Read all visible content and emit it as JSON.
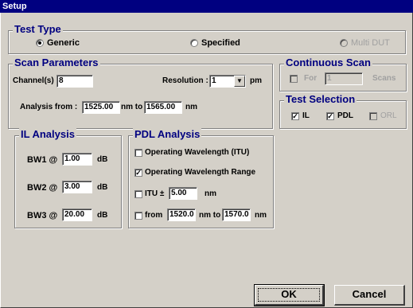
{
  "window": {
    "title": "Setup"
  },
  "test_type": {
    "legend": "Test Type",
    "options": [
      {
        "label": "Generic",
        "selected": true,
        "enabled": true
      },
      {
        "label": "Specified",
        "selected": false,
        "enabled": true
      },
      {
        "label": "Multi DUT",
        "selected": false,
        "enabled": false
      }
    ]
  },
  "scan_parameters": {
    "legend": "Scan Parameters",
    "channels_label": "Channel(s) :",
    "channels_value": "8",
    "resolution_label": "Resolution :",
    "resolution_value": "1",
    "resolution_unit": "pm",
    "analysis_from_label": "Analysis from :",
    "analysis_from_value": "1525.00",
    "nm_to_label": "nm to",
    "analysis_to_value": "1565.00",
    "nm_label": "nm"
  },
  "continuous_scan": {
    "legend": "Continuous Scan",
    "for_label": "For",
    "for_checked": false,
    "for_value": "1",
    "scans_label": "Scans"
  },
  "test_selection": {
    "legend": "Test Selection",
    "items": [
      {
        "label": "IL",
        "checked": true,
        "enabled": true
      },
      {
        "label": "PDL",
        "checked": true,
        "enabled": true
      },
      {
        "label": "ORL",
        "checked": false,
        "enabled": false
      }
    ]
  },
  "il_analysis": {
    "legend": "IL Analysis",
    "rows": [
      {
        "label": "BW1 @",
        "value": "1.00",
        "unit": "dB"
      },
      {
        "label": "BW2 @",
        "value": "3.00",
        "unit": "dB"
      },
      {
        "label": "BW3 @",
        "value": "20.00",
        "unit": "dB"
      }
    ]
  },
  "pdl_analysis": {
    "legend": "PDL Analysis",
    "operating_wavelength_itu": {
      "label": "Operating Wavelength (ITU)",
      "checked": false
    },
    "operating_wavelength_range": {
      "label": "Operating Wavelength Range",
      "checked": true
    },
    "itu": {
      "label": "ITU ±",
      "value": "5.00",
      "unit": "nm",
      "checked": false
    },
    "from": {
      "label": "from",
      "from_value": "1520.0",
      "mid_label": "nm to",
      "to_value": "1570.0",
      "unit": "nm",
      "checked": false
    }
  },
  "buttons": {
    "ok": "OK",
    "cancel": "Cancel"
  }
}
